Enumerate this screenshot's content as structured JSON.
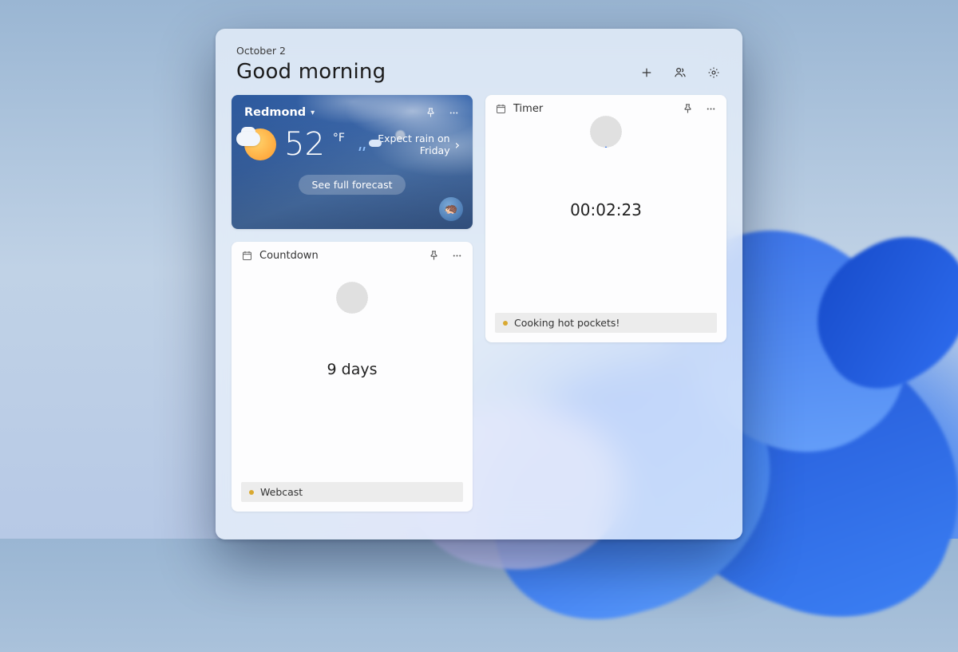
{
  "header": {
    "date": "October 2",
    "greeting": "Good morning"
  },
  "weather": {
    "location": "Redmond",
    "temperature": "52",
    "unit": "°F",
    "hint": "Expect rain on Friday",
    "see_forecast": "See full forecast"
  },
  "countdown": {
    "title": "Countdown",
    "value": "9 days",
    "label": "Webcast"
  },
  "timer": {
    "title": "Timer",
    "value": "00:02:23",
    "label": "Cooking hot pockets!",
    "active_ticks": 1,
    "total_ticks": 40
  }
}
